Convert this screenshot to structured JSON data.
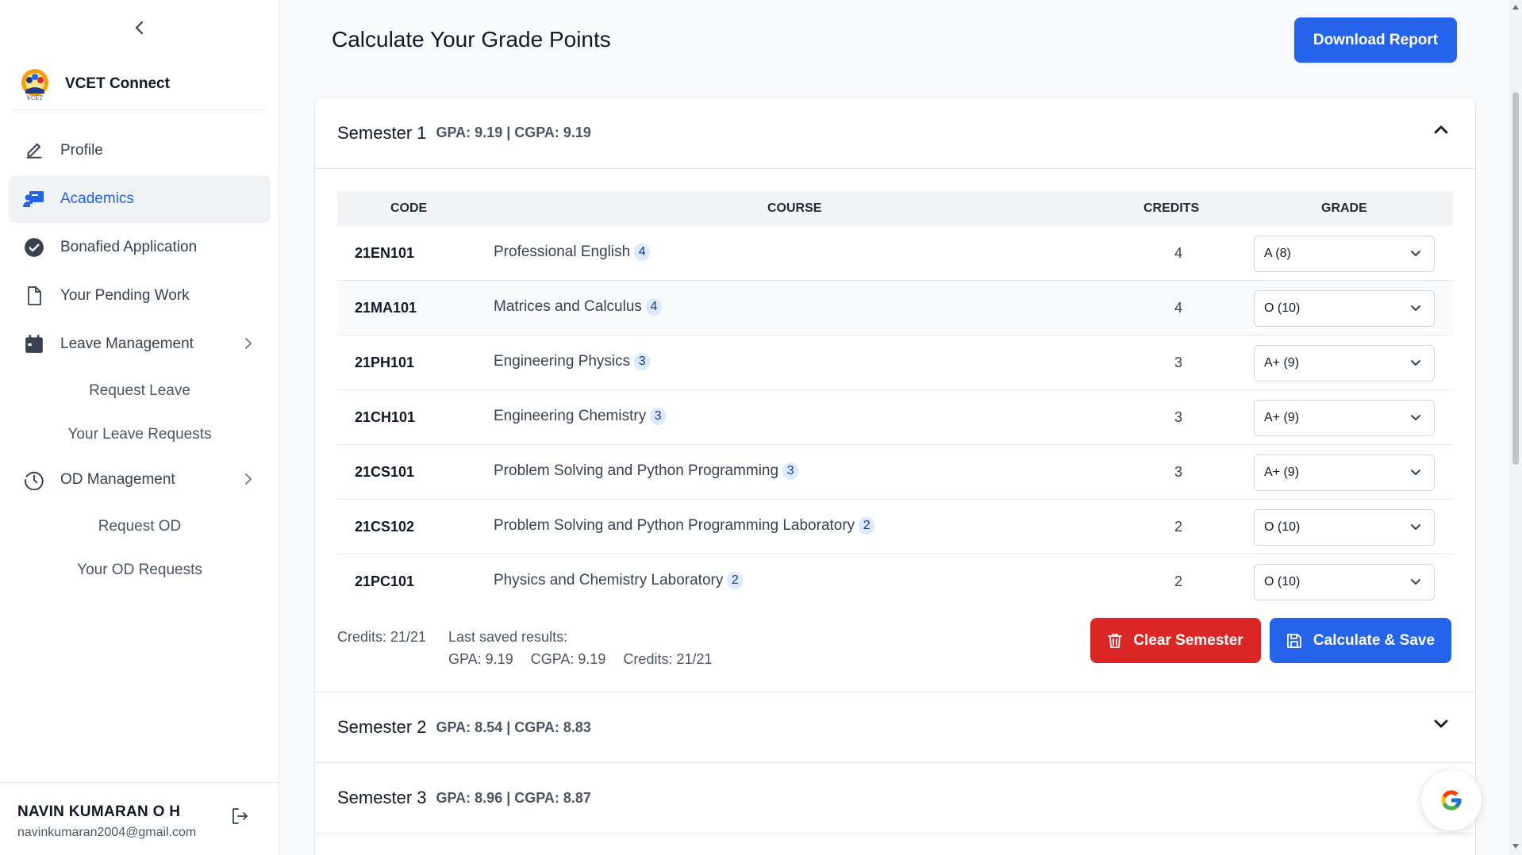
{
  "sidebar": {
    "brand": "VCET Connect",
    "items": [
      {
        "label": "Profile"
      },
      {
        "label": "Academics"
      },
      {
        "label": "Bonafied Application"
      },
      {
        "label": "Your Pending Work"
      },
      {
        "label": "Leave Management"
      },
      {
        "label": "OD Management"
      }
    ],
    "leave_sub": [
      "Request Leave",
      "Your Leave Requests"
    ],
    "od_sub": [
      "Request OD",
      "Your OD Requests"
    ],
    "user": {
      "name": "NAVIN KUMARAN O H",
      "email": "navinkumaran2004@gmail.com"
    }
  },
  "header": {
    "title": "Calculate Your Grade Points",
    "download_label": "Download Report"
  },
  "table_headers": {
    "code": "CODE",
    "course": "COURSE",
    "credits": "CREDITS",
    "grade": "GRADE"
  },
  "semesters": [
    {
      "title": "Semester 1",
      "meta": "GPA: 9.19 | CGPA: 9.19",
      "expanded": true
    },
    {
      "title": "Semester 2",
      "meta": "GPA: 8.54 | CGPA: 8.83",
      "expanded": false
    },
    {
      "title": "Semester 3",
      "meta": "GPA: 8.96 | CGPA: 8.87",
      "expanded": false
    }
  ],
  "courses": [
    {
      "code": "21EN101",
      "course": "Professional English",
      "badge": "4",
      "credits": "4",
      "grade": "A (8)"
    },
    {
      "code": "21MA101",
      "course": "Matrices and Calculus",
      "badge": "4",
      "credits": "4",
      "grade": "O (10)"
    },
    {
      "code": "21PH101",
      "course": "Engineering Physics",
      "badge": "3",
      "credits": "3",
      "grade": "A+ (9)"
    },
    {
      "code": "21CH101",
      "course": "Engineering Chemistry",
      "badge": "3",
      "credits": "3",
      "grade": "A+ (9)"
    },
    {
      "code": "21CS101",
      "course": "Problem Solving and Python Programming",
      "badge": "3",
      "credits": "3",
      "grade": "A+ (9)"
    },
    {
      "code": "21CS102",
      "course": "Problem Solving and Python Programming Laboratory",
      "badge": "2",
      "credits": "2",
      "grade": "O (10)"
    },
    {
      "code": "21PC101",
      "course": "Physics and Chemistry Laboratory",
      "badge": "2",
      "credits": "2",
      "grade": "O (10)"
    }
  ],
  "footer": {
    "credits": "Credits: 21/21",
    "last_saved": "Last saved results:",
    "gpa": "GPA: 9.19",
    "cgpa": "CGPA: 9.19",
    "saved_credits": "Credits: 21/21"
  },
  "actions": {
    "clear": "Clear Semester",
    "save": "Calculate & Save"
  },
  "colors": {
    "primary": "#2563eb",
    "danger": "#dc2626",
    "badge_bg": "#dbeafe"
  }
}
